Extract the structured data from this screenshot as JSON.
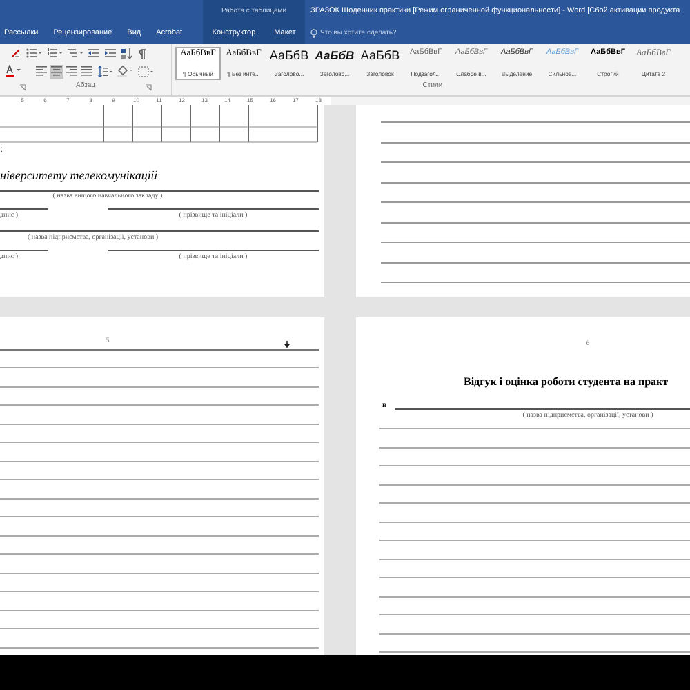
{
  "title_bar": {
    "context_label": "Работа с таблицами",
    "title": "ЗРАЗОК  Щоденник практики [Режим ограниченной функциональности] - Word [Сбой активации продукта"
  },
  "tabs": [
    {
      "label": "Рассылки",
      "selected": false,
      "contextual": false
    },
    {
      "label": "Рецензирование",
      "selected": false,
      "contextual": false
    },
    {
      "label": "Вид",
      "selected": false,
      "contextual": false
    },
    {
      "label": "Acrobat",
      "selected": false,
      "contextual": false
    },
    {
      "label": "Конструктор",
      "selected": false,
      "contextual": true
    },
    {
      "label": "Макет",
      "selected": false,
      "contextual": true
    }
  ],
  "tell_me": {
    "placeholder": "Что вы хотите сделать?"
  },
  "paragraph_group": {
    "label": "Абзац",
    "align_buttons": [
      {
        "kind": "left",
        "selected": false
      },
      {
        "kind": "center",
        "selected": true
      },
      {
        "kind": "right",
        "selected": false
      },
      {
        "kind": "justify",
        "selected": false
      }
    ]
  },
  "styles_group": {
    "label": "Стили",
    "styles": [
      {
        "preview": "АаБбВвГ",
        "label": "¶ Обычный",
        "kind": "normal",
        "selected": true
      },
      {
        "preview": "АаБбВвГ",
        "label": "¶ Без инте...",
        "kind": "normal",
        "selected": false
      },
      {
        "preview": "АаБбВ",
        "label": "Заголово...",
        "kind": "heading",
        "selected": false
      },
      {
        "preview": "АаБбВ",
        "label": "Заголово...",
        "kind": "heading_italic",
        "selected": false
      },
      {
        "preview": "АаБбВ",
        "label": "Заголовок",
        "kind": "heading",
        "selected": false
      },
      {
        "preview": "АаБбВвГ",
        "label": "Подзагол...",
        "kind": "subtitle",
        "selected": false
      },
      {
        "preview": "АаБбВвГ",
        "label": "Слабое в...",
        "kind": "subtle",
        "selected": false
      },
      {
        "preview": "АаБбВвГ",
        "label": "Выделение",
        "kind": "emphasis",
        "selected": false
      },
      {
        "preview": "АаБбВвГ",
        "label": "Сильное...",
        "kind": "intense",
        "selected": false
      },
      {
        "preview": "АаБбВвГ",
        "label": "Строгий",
        "kind": "strong",
        "selected": false
      },
      {
        "preview": "АаБбВвГ",
        "label": "Цитата 2",
        "kind": "quote",
        "selected": false
      }
    ]
  },
  "ruler": {
    "numbers": [
      "5",
      "6",
      "7",
      "8",
      "9",
      "10",
      "11",
      "12",
      "13",
      "14",
      "15",
      "16",
      "17",
      "18"
    ]
  },
  "page_top_left": {
    "colon": ":",
    "institution": "ніверситету телекомунікацій",
    "institution_caption": "( назва вищого навчального закладу )",
    "signature_caption_1": "дпис )",
    "name_caption_1": "( прізвище та ініціали )",
    "enterprise_caption": "( назва підприємства, організації, установи )",
    "signature_caption_2": "дпис )",
    "name_caption_2": "( прізвище та ініціали )"
  },
  "page_bottom_left": {
    "page_number": "5"
  },
  "page_bottom_right": {
    "page_number": "6",
    "heading": "Відгук і оцінка роботи студента на практ",
    "prefix": "в",
    "enterprise_caption": "( назва підприємства, організації, установи )"
  }
}
